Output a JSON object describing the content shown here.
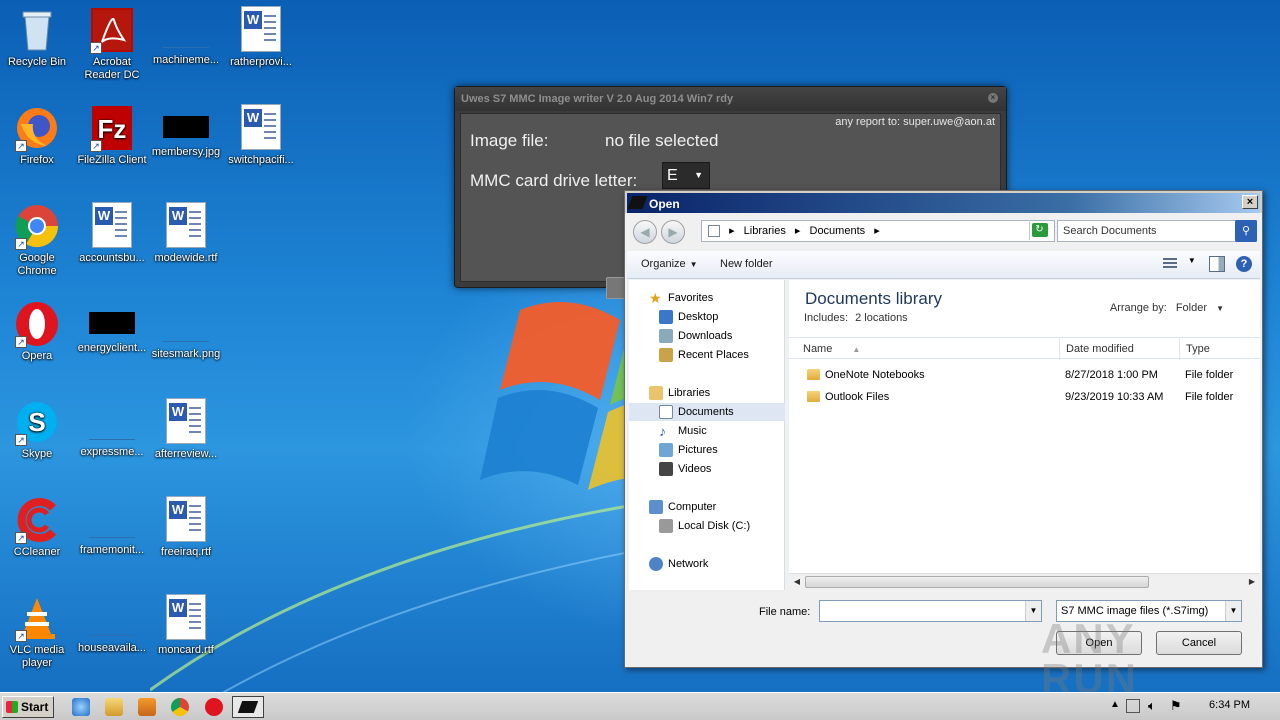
{
  "desktop": {
    "icons": [
      {
        "label": "Recycle Bin"
      },
      {
        "label": "Acrobat Reader DC"
      },
      {
        "label": "machineme..."
      },
      {
        "label": "ratherprovi..."
      },
      {
        "label": "Firefox"
      },
      {
        "label": "FileZilla Client"
      },
      {
        "label": "membersy.jpg"
      },
      {
        "label": "switchpacifi..."
      },
      {
        "label": "Google Chrome"
      },
      {
        "label": "accountsbu..."
      },
      {
        "label": "modewide.rtf"
      },
      {
        "label": "Opera"
      },
      {
        "label": "energyclient..."
      },
      {
        "label": "sitesmark.png"
      },
      {
        "label": "Skype"
      },
      {
        "label": "expressme..."
      },
      {
        "label": "afterreview..."
      },
      {
        "label": "CCleaner"
      },
      {
        "label": "framemonit..."
      },
      {
        "label": "freeiraq.rtf"
      },
      {
        "label": "VLC media player"
      },
      {
        "label": "houseavaila..."
      },
      {
        "label": "moncard.rtf"
      }
    ]
  },
  "s7window": {
    "title": "Uwes S7 MMC Image writer V 2.0  Aug 2014 Win7 rdy",
    "report": "any report to: super.uwe@aon.at",
    "image_file_label": "Image file:",
    "image_file_value": "no file selected",
    "drive_label": "MMC card drive letter:",
    "drive_value": "E"
  },
  "open_dialog": {
    "title": "Open",
    "breadcrumb": [
      "Libraries",
      "Documents"
    ],
    "search_placeholder": "Search Documents",
    "organize": "Organize",
    "new_folder": "New folder",
    "nav": {
      "favorites": "Favorites",
      "desktop": "Desktop",
      "downloads": "Downloads",
      "recent": "Recent Places",
      "libraries": "Libraries",
      "documents": "Documents",
      "music": "Music",
      "pictures": "Pictures",
      "videos": "Videos",
      "computer": "Computer",
      "local_disk": "Local Disk (C:)",
      "network": "Network"
    },
    "library_title": "Documents library",
    "includes_label": "Includes:",
    "includes_value": "2 locations",
    "arrange_label": "Arrange by:",
    "arrange_value": "Folder",
    "columns": {
      "name": "Name",
      "date": "Date modified",
      "type": "Type"
    },
    "files": [
      {
        "name": "OneNote Notebooks",
        "date": "8/27/2018 1:00 PM",
        "type": "File folder"
      },
      {
        "name": "Outlook Files",
        "date": "9/23/2019 10:33 AM",
        "type": "File folder"
      }
    ],
    "filename_label": "File name:",
    "filename_value": "",
    "filter": "S7 MMC image files (*.S7img)",
    "open_button": "Open",
    "cancel_button": "Cancel"
  },
  "taskbar": {
    "start": "Start",
    "clock": "6:34 PM"
  },
  "watermark": "ANY RUN"
}
